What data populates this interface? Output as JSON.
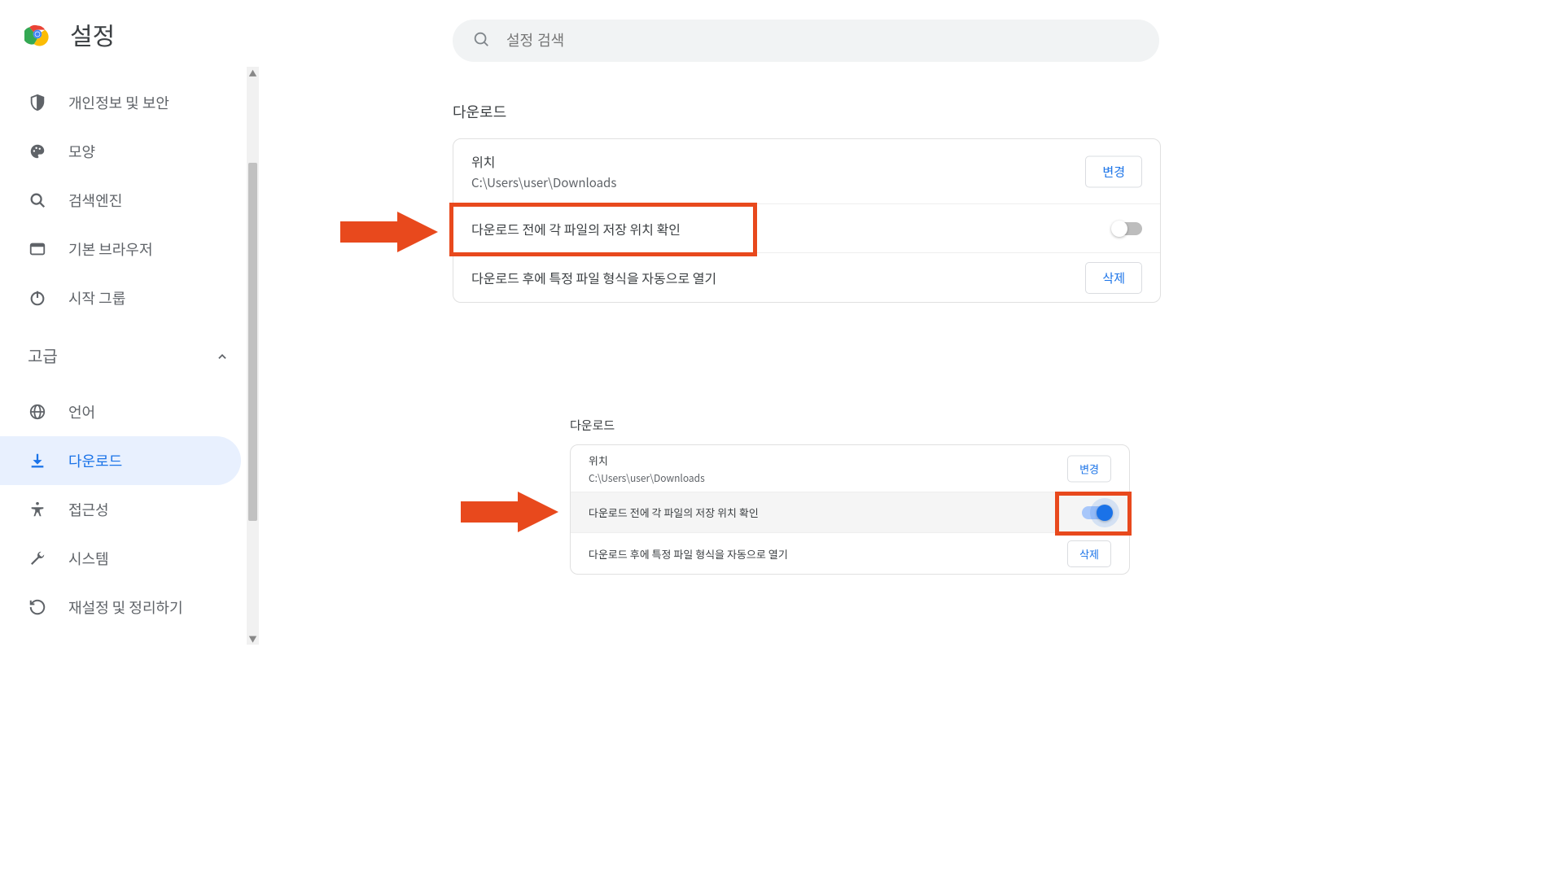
{
  "header": {
    "title": "설정"
  },
  "search": {
    "placeholder": "설정 검색"
  },
  "sidebar": {
    "items": [
      {
        "label": "개인정보 및 보안",
        "icon": "shield"
      },
      {
        "label": "모양",
        "icon": "palette"
      },
      {
        "label": "검색엔진",
        "icon": "search"
      },
      {
        "label": "기본 브라우저",
        "icon": "browser"
      },
      {
        "label": "시작 그룹",
        "icon": "power"
      }
    ],
    "advanced_label": "고급",
    "advanced_items": [
      {
        "label": "언어",
        "icon": "globe"
      },
      {
        "label": "다운로드",
        "icon": "download",
        "active": true
      },
      {
        "label": "접근성",
        "icon": "accessibility"
      },
      {
        "label": "시스템",
        "icon": "wrench"
      },
      {
        "label": "재설정 및 정리하기",
        "icon": "restore"
      }
    ]
  },
  "downloads_top": {
    "heading": "다운로드",
    "location_label": "위치",
    "location_path": "C:\\Users\\user\\Downloads",
    "change_btn": "변경",
    "ask_label": "다운로드 전에 각 파일의 저장 위치 확인",
    "ask_value": false,
    "auto_open_label": "다운로드 후에 특정 파일 형식을 자동으로 열기",
    "delete_btn": "삭제"
  },
  "downloads_bot": {
    "heading": "다운로드",
    "location_label": "위치",
    "location_path": "C:\\Users\\user\\Downloads",
    "change_btn": "변경",
    "ask_label": "다운로드 전에 각 파일의 저장 위치 확인",
    "ask_value": true,
    "auto_open_label": "다운로드 후에 특정 파일 형식을 자동으로 열기",
    "delete_btn": "삭제"
  },
  "colors": {
    "accent": "#1a73e8",
    "annotation": "#e8491d"
  }
}
